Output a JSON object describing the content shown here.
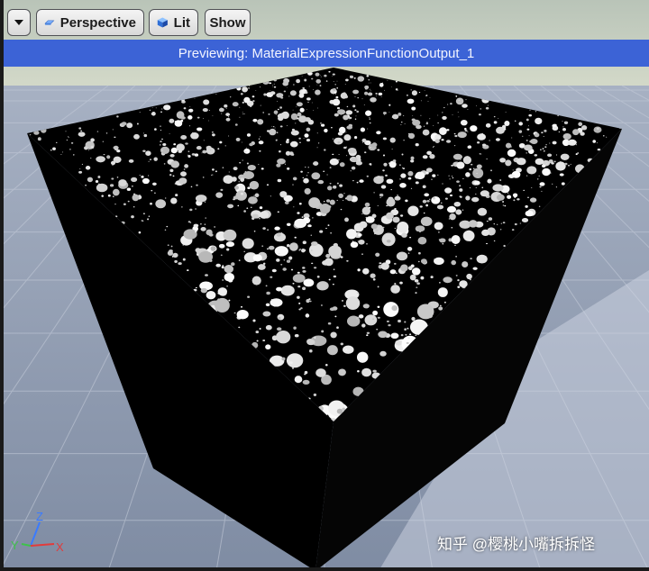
{
  "toolbar": {
    "menu_icon": "chevron-down-icon",
    "perspective_label": "Perspective",
    "perspective_icon": "perspective-view-icon",
    "lit_label": "Lit",
    "lit_icon": "lit-cube-icon",
    "show_label": "Show"
  },
  "banner": {
    "text": "Previewing: MaterialExpressionFunctionOutput_1",
    "color": "#3c63d6"
  },
  "axis_gizmo": {
    "z_label": "Z",
    "y_label": "Y",
    "x_label": "X",
    "z_color": "#3a7bff",
    "y_color": "#3fc24a",
    "x_color": "#e23b3b"
  },
  "watermark": {
    "text": "知乎 @樱桃小嘴拆拆怪"
  },
  "colors": {
    "floor": "#8e9bb1",
    "sky": "#c8d0c0",
    "material_dark": "#000000",
    "pebble": "#e8e8e8"
  }
}
